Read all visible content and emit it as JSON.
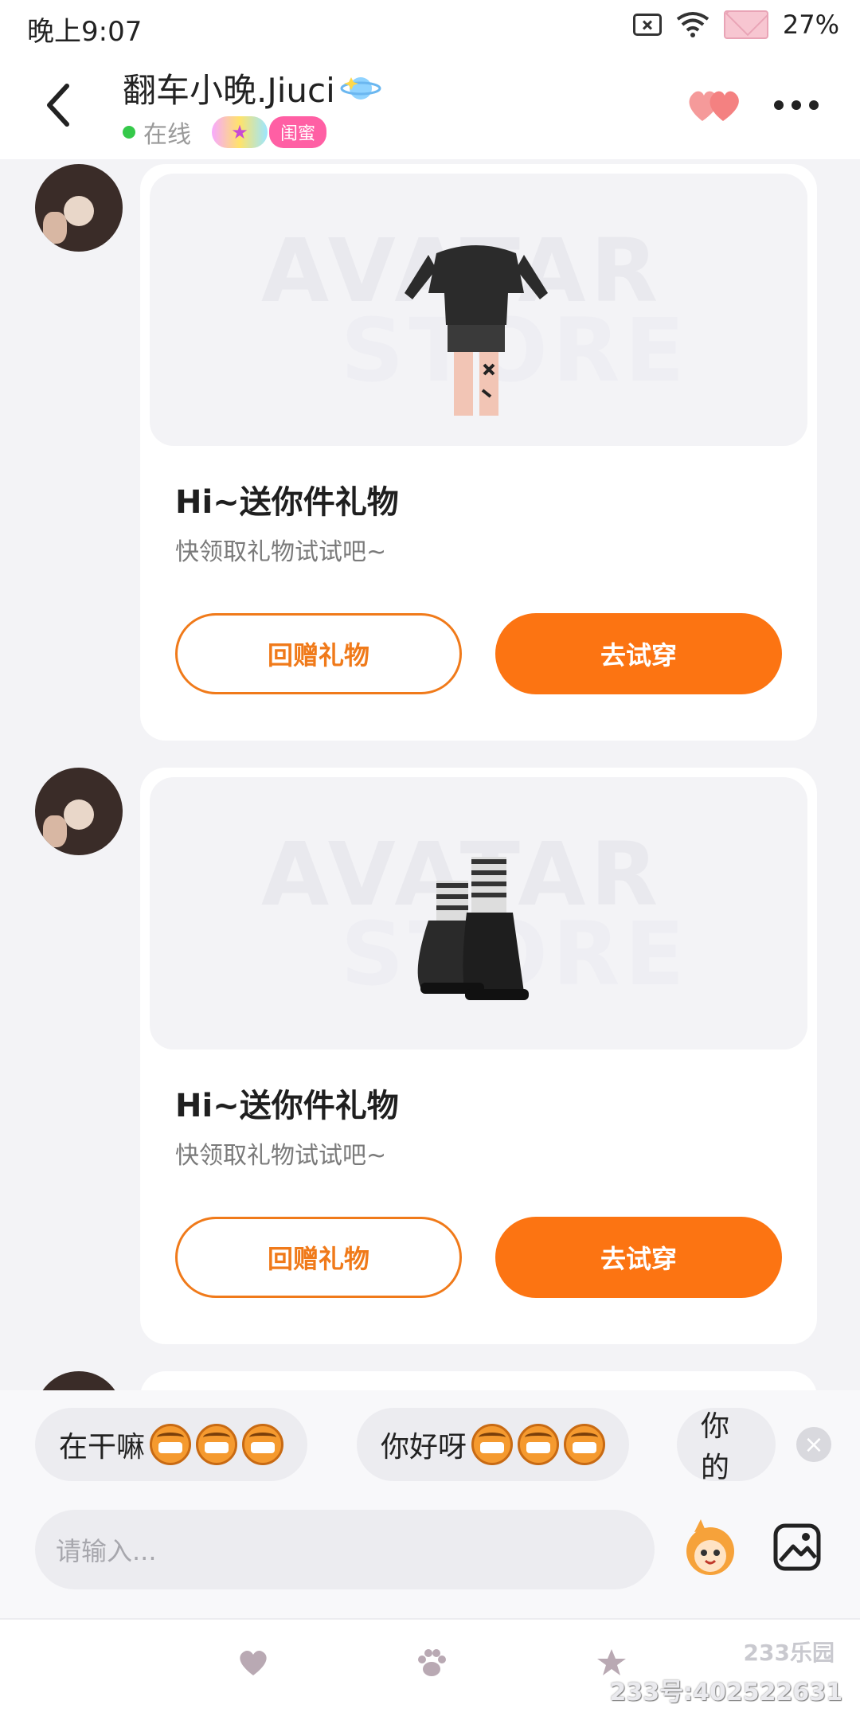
{
  "status_bar": {
    "time": "晚上9:07",
    "battery": "27%"
  },
  "header": {
    "name": "翻车小晚.Jiuci",
    "online": "在线",
    "relation_badge": "闺蜜"
  },
  "messages": [
    {
      "title": "Hi~送你件礼物",
      "subtitle": "快领取礼物试试吧~",
      "gift_back": "回赠礼物",
      "try_on": "去试穿",
      "watermark_top": "AVATAR",
      "watermark_bottom": "STORE"
    },
    {
      "title": "Hi~送你件礼物",
      "subtitle": "快领取礼物试试吧~",
      "gift_back": "回赠礼物",
      "try_on": "去试穿",
      "watermark_top": "AVATAR",
      "watermark_bottom": "STORE"
    }
  ],
  "quick_replies": [
    "在干嘛",
    "你好呀",
    "你的"
  ],
  "input": {
    "placeholder": "请输入..."
  },
  "footer": {
    "logo": "233乐园",
    "id_text": "233号:402522631"
  }
}
